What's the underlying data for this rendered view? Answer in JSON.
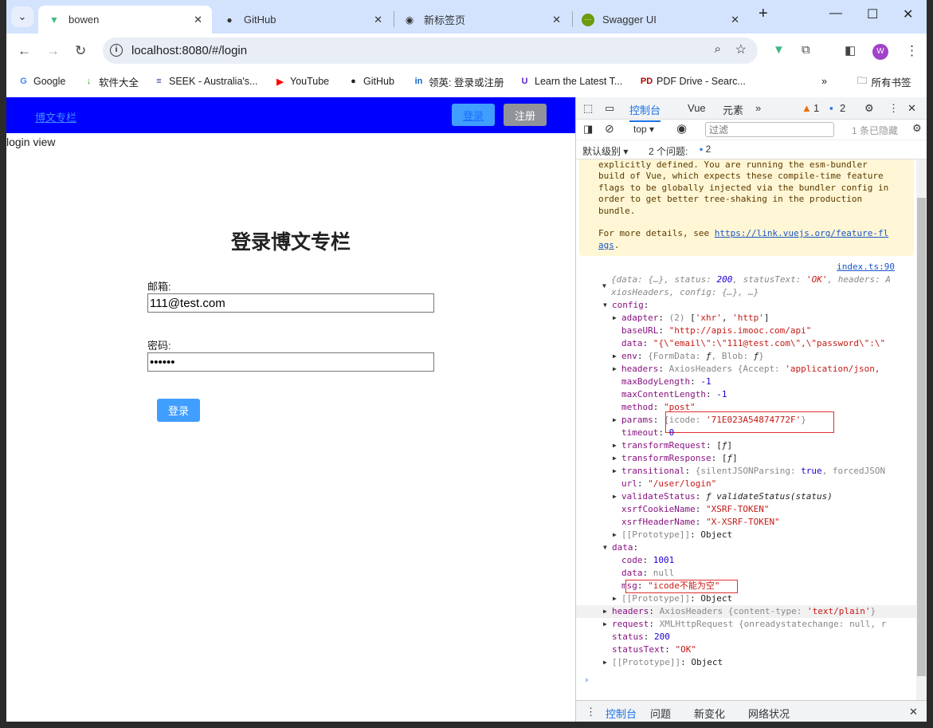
{
  "browser": {
    "tabs": [
      {
        "label": "bowen",
        "icon": "vue-icon",
        "active": true
      },
      {
        "label": "GitHub",
        "icon": "github-icon"
      },
      {
        "label": "新标签页",
        "icon": "chrome-icon"
      },
      {
        "label": "Swagger UI",
        "icon": "swagger-icon"
      }
    ],
    "url": "localhost:8080/#/login",
    "profile_initial": "W",
    "bookmarks": [
      {
        "label": "Google",
        "icon": "G",
        "color": "#4285f4"
      },
      {
        "label": "软件大全",
        "icon": "↓",
        "color": "#2db400"
      },
      {
        "label": "SEEK - Australia's...",
        "icon": "≡",
        "color": "#1c3f94"
      },
      {
        "label": "YouTube",
        "icon": "▶",
        "color": "#ff0000"
      },
      {
        "label": "GitHub",
        "icon": "●",
        "color": "#222"
      },
      {
        "label": "领英: 登录或注册",
        "icon": "in",
        "color": "#0a66c2"
      },
      {
        "label": "Learn the Latest T...",
        "icon": "U",
        "color": "#5624d0"
      },
      {
        "label": "PDF Drive - Searc...",
        "icon": "PD",
        "color": "#a00"
      }
    ],
    "all_bookmarks": "所有书签"
  },
  "app": {
    "brand": "博文专栏",
    "login_btn": "登录",
    "register_btn": "注册",
    "view_label": "login view",
    "title": "登录博文专栏",
    "email_label": "邮箱:",
    "email_value": "111@test.com",
    "password_label": "密码:",
    "password_value": "••••••",
    "submit": "登录",
    "colors": {
      "nav": "#0000ff",
      "primary": "#409eff",
      "secondary": "#909399"
    }
  },
  "devtools": {
    "tabs": [
      "控制台",
      "Vue",
      "元素"
    ],
    "warnings": "1",
    "issues_count": "2",
    "context": "top",
    "filter_placeholder": "过滤",
    "hidden": "1 条已隐藏",
    "level": "默认级别",
    "issues_label": "2 个问题:",
    "issues_badge": "2",
    "warning_text": "explicitly defined. You are running the esm-bundler\nbuild of Vue, which expects these compile-time feature\nflags to be globally injected via the bundler config in\norder to get better tree-shaking in the production\nbundle.\n\nFor more details, see ",
    "warning_link": "https://link.vuejs.org/feature-fl\nags",
    "source": "index.ts:90",
    "lines": [
      {
        "lv": 0,
        "a": "▼",
        "seg": [
          [
            "{data: {…}, status: ",
            "v-gray v-it"
          ],
          [
            "200",
            "v-num v-it"
          ],
          [
            ", statusText: ",
            "v-gray v-it"
          ],
          [
            "'OK'",
            "v-str v-it"
          ],
          [
            ", headers: A",
            "v-gray v-it"
          ]
        ]
      },
      {
        "lv": 0,
        "a": "",
        "seg": [
          [
            "xiosHeaders, config: {…}, …}",
            "v-gray v-it"
          ]
        ]
      },
      {
        "lv": 1,
        "a": "▼",
        "k": "config",
        "seg": []
      },
      {
        "lv": 2,
        "a": "▶",
        "k": "adapter",
        "seg": [
          [
            "(2) ",
            "v-gray"
          ],
          [
            "[",
            "v-dk"
          ],
          [
            "'xhr'",
            "v-str"
          ],
          [
            ", ",
            "v-dk"
          ],
          [
            "'http'",
            "v-str"
          ],
          [
            "]",
            "v-dk"
          ]
        ]
      },
      {
        "lv": 2,
        "a": "",
        "k": "baseURL",
        "seg": [
          [
            "\"http://apis.imooc.com/api\"",
            "v-str"
          ]
        ]
      },
      {
        "lv": 2,
        "a": "",
        "k": "data",
        "seg": [
          [
            "\"{\\\"email\\\":\\\"111@test.com\\\",\\\"password\\\":\\\"",
            "v-str"
          ]
        ]
      },
      {
        "lv": 2,
        "a": "▶",
        "k": "env",
        "seg": [
          [
            "{FormData: ",
            "v-gray"
          ],
          [
            "ƒ",
            "v-dk v-it"
          ],
          [
            ", Blob: ",
            "v-gray"
          ],
          [
            "ƒ",
            "v-dk v-it"
          ],
          [
            "}",
            "v-gray"
          ]
        ]
      },
      {
        "lv": 2,
        "a": "▶",
        "k": "headers",
        "seg": [
          [
            "AxiosHeaders {Accept: ",
            "v-gray"
          ],
          [
            "'application/json,",
            "v-str"
          ]
        ]
      },
      {
        "lv": 2,
        "a": "",
        "k": "maxBodyLength",
        "seg": [
          [
            "-1",
            "v-num"
          ]
        ]
      },
      {
        "lv": 2,
        "a": "",
        "k": "maxContentLength",
        "seg": [
          [
            "-1",
            "v-num"
          ]
        ]
      },
      {
        "lv": 2,
        "a": "",
        "k": "method",
        "seg": [
          [
            "\"post\"",
            "v-str"
          ]
        ]
      },
      {
        "lv": 2,
        "a": "▶",
        "k": "params",
        "seg": [
          [
            "{icode: ",
            "v-gray"
          ],
          [
            "'71E023A54874772F'",
            "v-str"
          ],
          [
            "}",
            "v-gray"
          ]
        ],
        "box": "params"
      },
      {
        "lv": 2,
        "a": "",
        "k": "timeout",
        "seg": [
          [
            "0",
            "v-num"
          ]
        ]
      },
      {
        "lv": 2,
        "a": "▶",
        "k": "transformRequest",
        "seg": [
          [
            "[",
            "v-dk"
          ],
          [
            "ƒ",
            "v-dk v-it"
          ],
          [
            "]",
            "v-dk"
          ]
        ]
      },
      {
        "lv": 2,
        "a": "▶",
        "k": "transformResponse",
        "seg": [
          [
            "[",
            "v-dk"
          ],
          [
            "ƒ",
            "v-dk v-it"
          ],
          [
            "]",
            "v-dk"
          ]
        ]
      },
      {
        "lv": 2,
        "a": "▶",
        "k": "transitional",
        "seg": [
          [
            "{silentJSONParsing: ",
            "v-gray"
          ],
          [
            "true",
            "v-num"
          ],
          [
            ", forcedJSON",
            "v-gray"
          ]
        ]
      },
      {
        "lv": 2,
        "a": "",
        "k": "url",
        "seg": [
          [
            "\"/user/login\"",
            "v-str"
          ]
        ]
      },
      {
        "lv": 2,
        "a": "▶",
        "k": "validateStatus",
        "seg": [
          [
            "ƒ validateStatus(status)",
            "v-dk v-it"
          ]
        ]
      },
      {
        "lv": 2,
        "a": "",
        "k": "xsrfCookieName",
        "seg": [
          [
            "\"XSRF-TOKEN\"",
            "v-str"
          ]
        ]
      },
      {
        "lv": 2,
        "a": "",
        "k": "xsrfHeaderName",
        "seg": [
          [
            "\"X-XSRF-TOKEN\"",
            "v-str"
          ]
        ]
      },
      {
        "lv": 2,
        "a": "▶",
        "seg": [
          [
            "[[Prototype]]",
            "v-gray"
          ],
          [
            ": Object",
            "v-dk"
          ]
        ]
      },
      {
        "lv": 1,
        "a": "▼",
        "k": "data",
        "seg": []
      },
      {
        "lv": 2,
        "a": "",
        "k": "code",
        "seg": [
          [
            "1001",
            "v-num"
          ]
        ]
      },
      {
        "lv": 2,
        "a": "",
        "k": "data",
        "seg": [
          [
            "null",
            "v-gray"
          ]
        ]
      },
      {
        "lv": 2,
        "a": "",
        "k": "msg",
        "seg": [
          [
            "\"icode不能为空\"",
            "v-str"
          ]
        ],
        "box": "msg"
      },
      {
        "lv": 2,
        "a": "▶",
        "seg": [
          [
            "[[Prototype]]",
            "v-gray"
          ],
          [
            ": Object",
            "v-dk"
          ]
        ]
      },
      {
        "lv": 1,
        "a": "▶",
        "k": "headers",
        "seg": [
          [
            "AxiosHeaders {content-type: ",
            "v-gray"
          ],
          [
            "'text/plain'",
            "v-str"
          ],
          [
            "}",
            "v-gray"
          ]
        ],
        "hl": true
      },
      {
        "lv": 1,
        "a": "▶",
        "k": "request",
        "seg": [
          [
            "XMLHttpRequest {onreadystatechange: ",
            "v-gray"
          ],
          [
            "null",
            "v-gray"
          ],
          [
            ", r",
            "v-gray"
          ]
        ]
      },
      {
        "lv": 1,
        "a": "",
        "k": "status",
        "seg": [
          [
            "200",
            "v-num"
          ]
        ]
      },
      {
        "lv": 1,
        "a": "",
        "k": "statusText",
        "seg": [
          [
            "\"OK\"",
            "v-str"
          ]
        ]
      },
      {
        "lv": 1,
        "a": "▶",
        "seg": [
          [
            "[[Prototype]]",
            "v-gray"
          ],
          [
            ": Object",
            "v-dk"
          ]
        ]
      }
    ],
    "prompt": "›",
    "drawer_tabs": [
      "控制台",
      "问题",
      "新变化",
      "网络状况"
    ]
  }
}
